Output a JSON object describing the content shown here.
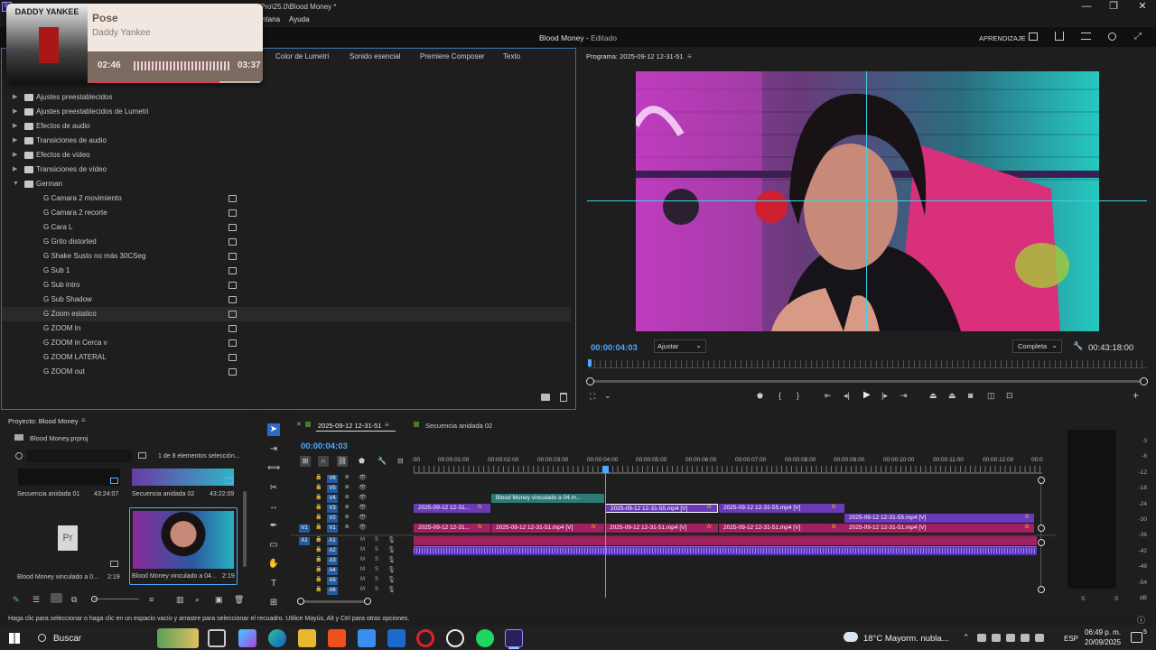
{
  "window": {
    "title_path": "Pro\\25.0\\Blood Money *",
    "min": "—",
    "max": "❐",
    "close": "✕"
  },
  "menu": {
    "items": [
      "ntana",
      "Ayuda"
    ]
  },
  "header": {
    "title": "Blood Money",
    "separator": " - ",
    "status": "Editado",
    "learn": "APRENDIZAJE"
  },
  "music_widget": {
    "song": "Pose",
    "artist": "Daddy Yankee",
    "elapsed": "02:46",
    "total": "03:37",
    "progress": 0.76,
    "album_art_text": "DADDY YANKEE"
  },
  "effects_tabs": [
    "Color de Lumetri",
    "Sonido esencial",
    "Premiere Composer",
    "Texto"
  ],
  "effects_tree": [
    {
      "label": "Ajustes preestablecidos",
      "type": "folder",
      "expanded": false
    },
    {
      "label": "Ajustes preestablecidos de Lumetri",
      "type": "folder",
      "expanded": false
    },
    {
      "label": "Efectos de audio",
      "type": "folder",
      "expanded": false
    },
    {
      "label": "Transiciones de audio",
      "type": "folder",
      "expanded": false
    },
    {
      "label": "Efectos de vídeo",
      "type": "folder",
      "expanded": false
    },
    {
      "label": "Transiciones de vídeo",
      "type": "folder",
      "expanded": false
    },
    {
      "label": "German",
      "type": "folder",
      "expanded": true
    },
    {
      "label": "G Camara 2 movimiento",
      "type": "preset"
    },
    {
      "label": "G Camara 2 recorte",
      "type": "preset"
    },
    {
      "label": "G Cara L",
      "type": "preset"
    },
    {
      "label": "G Grito distorted",
      "type": "preset"
    },
    {
      "label": "G Shake Susto no más 30CSeg",
      "type": "preset"
    },
    {
      "label": "G Sub 1",
      "type": "preset"
    },
    {
      "label": "G Sub intro",
      "type": "preset"
    },
    {
      "label": "G Sub Shadow",
      "type": "preset"
    },
    {
      "label": "G Zoom estatico",
      "type": "preset",
      "selected": true
    },
    {
      "label": "G ZOOM In",
      "type": "preset"
    },
    {
      "label": "G ZOOM in Cerca v",
      "type": "preset"
    },
    {
      "label": "G ZOOM LATERAL",
      "type": "preset"
    },
    {
      "label": "G ZOOM out",
      "type": "preset"
    }
  ],
  "program": {
    "title": "Programa: 2025-09-12 12-31-51",
    "timecode": "00:00:04:03",
    "fit": "Ajustar",
    "quality": "Completa",
    "duration": "00:43:18:00"
  },
  "project": {
    "title": "Proyecto: Blood Money",
    "file": "Blood Money.prproj",
    "search_placeholder": "",
    "count": "1 de 8 elementos selección...",
    "items": [
      {
        "name": "Secuencia anidada 01",
        "duration": "43:24:07"
      },
      {
        "name": "Secuencia anidada 02",
        "duration": "43:22:09"
      },
      {
        "name": "Blood Money vinculado a 0...",
        "duration": "2:19"
      },
      {
        "name": "Blood Money vinculado a 04...",
        "duration": "2:19",
        "selected": true
      }
    ]
  },
  "timeline": {
    "tabs": [
      "2025-09-12 12-31-51",
      "Secuencia anidada 02"
    ],
    "timecode": "00:00:04:03",
    "ruler": [
      ":00",
      "00:00:01:00",
      "00:00:02:00",
      "00:00:03:00",
      "00:00:04:00",
      "00:00:05:00",
      "00:00:06:00",
      "00:00:07:00",
      "00:00:08:00",
      "00:00:09:00",
      "00:00:10:00",
      "00:00:11:00",
      "00:00:12:00",
      "00:0"
    ],
    "video_tracks": [
      "V6",
      "V5",
      "V4",
      "V3",
      "V2",
      "V1"
    ],
    "audio_tracks": [
      "A1",
      "A2",
      "A3",
      "A4",
      "A5",
      "A6"
    ],
    "source_patch": {
      "video": "V1",
      "audio": "A1"
    },
    "track_buttons": {
      "mute": "M",
      "solo": "S"
    },
    "clips": {
      "v4_nest": "Blood Money vinculado a 04.m...",
      "v3": [
        "2025-09-12 12-31...",
        "2025-09-12 12-31-55.mp4 [V]",
        "2025-09-12 12-31-55.mp4 [V]"
      ],
      "v2": "2025-09-12 12-31-55.mp4 [V]",
      "v1": [
        "2025-09-12 12-31...",
        "2025-09-12 12-31-51.mp4 [V]",
        "2025-09-12 12-31-51.mp4 [V]",
        "2025-09-12 12-31-51.mp4 [V]",
        "2025-09-12 12-31-51.mp4 [V]"
      ],
      "fx": "fx"
    }
  },
  "meter": {
    "scale": [
      "0",
      "-6",
      "-12",
      "-18",
      "-24",
      "-30",
      "-36",
      "-42",
      "-48",
      "-54",
      "dB"
    ],
    "solo": [
      "S",
      "S"
    ]
  },
  "status": {
    "hint": "Haga clic para seleccionar o haga clic en un espacio vacío y arrastre para seleccionar el recuadro. Utilice Mayús, Alt y Ctrl para otras opciones."
  },
  "taskbar": {
    "search": "Buscar",
    "weather": "18°C  Mayorm. nubla...",
    "lang": "ESP",
    "time": "06:49 p. m.",
    "date": "20/09/2025",
    "notif": "5"
  },
  "colors": {
    "accent": "#2d8ceb",
    "v1_clip": "#a02060",
    "v3_clip": "#6a3ab8",
    "nest_clip": "#2d7a76",
    "audio_clip": "#5a37b8",
    "playhead": "#4fa8ff"
  }
}
